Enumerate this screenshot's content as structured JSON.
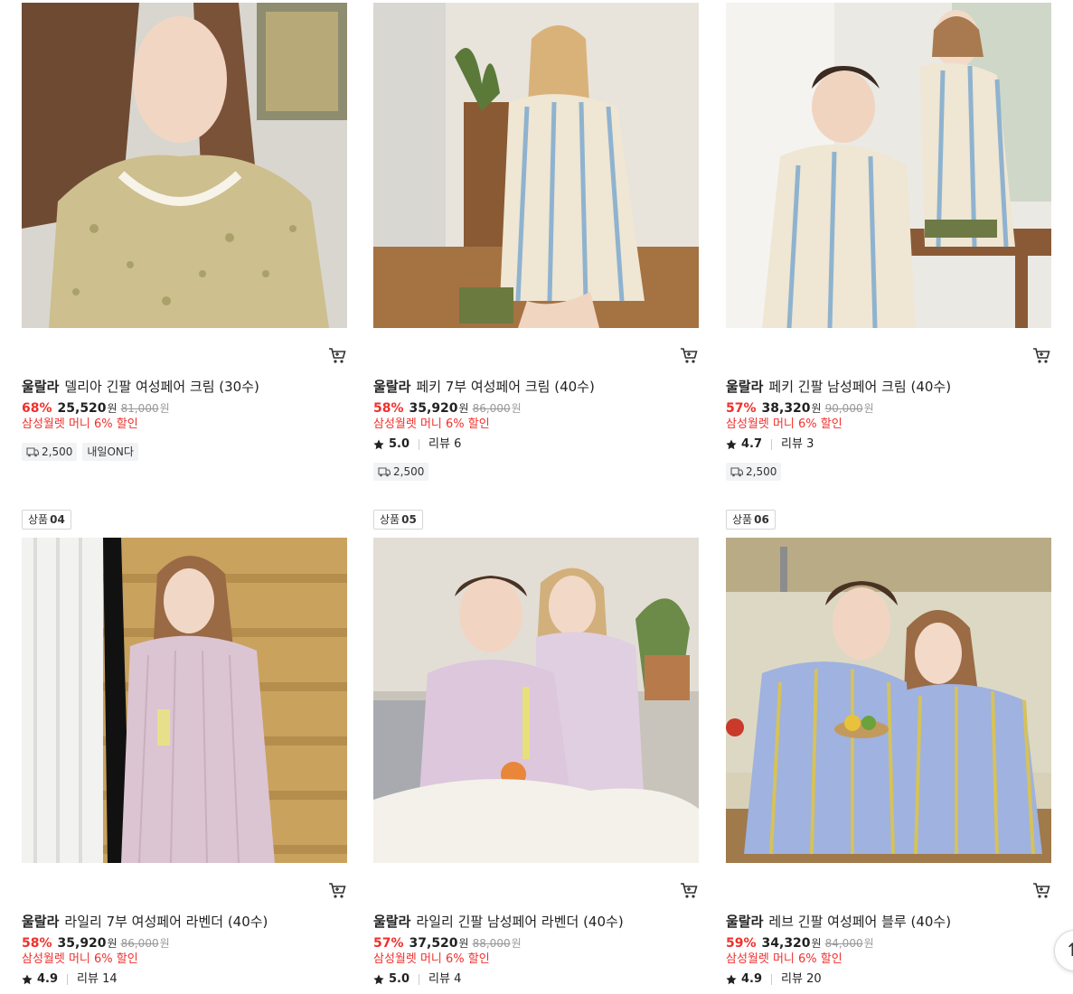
{
  "products": [
    {
      "brand": "울랄라",
      "name": "델리아 긴팔 여성페어 크림 (30수)",
      "discount": "68%",
      "price": "25,520",
      "unit": "원",
      "original": "81,000",
      "promo": "삼성월렛 머니 6% 할인",
      "shipping": "2,500",
      "delivery": "내일ON다"
    },
    {
      "brand": "울랄라",
      "name": "페키 7부 여성페어 크림 (40수)",
      "discount": "58%",
      "price": "35,920",
      "unit": "원",
      "original": "86,000",
      "promo": "삼성월렛 머니 6% 할인",
      "rating": "5.0",
      "reviews": "리뷰 6",
      "shipping": "2,500"
    },
    {
      "brand": "울랄라",
      "name": "페키 긴팔 남성페어 크림 (40수)",
      "discount": "57%",
      "price": "38,320",
      "unit": "원",
      "original": "90,000",
      "promo": "삼성월렛 머니 6% 할인",
      "rating": "4.7",
      "reviews": "리뷰 3",
      "shipping": "2,500"
    },
    {
      "rank_label": "상품",
      "rank": "04",
      "brand": "울랄라",
      "name": "라일리 7부 여성페어 라벤더 (40수)",
      "discount": "58%",
      "price": "35,920",
      "unit": "원",
      "original": "86,000",
      "promo": "삼성월렛 머니 6% 할인",
      "rating": "4.9",
      "reviews": "리뷰 14"
    },
    {
      "rank_label": "상품",
      "rank": "05",
      "brand": "울랄라",
      "name": "라일리 긴팔 남성페어 라벤더 (40수)",
      "discount": "57%",
      "price": "37,520",
      "unit": "원",
      "original": "88,000",
      "promo": "삼성월렛 머니 6% 할인",
      "rating": "5.0",
      "reviews": "리뷰 4"
    },
    {
      "rank_label": "상품",
      "rank": "06",
      "brand": "울랄라",
      "name": "레브 긴팔 여성페어 블루 (40수)",
      "discount": "59%",
      "price": "34,320",
      "unit": "원",
      "original": "84,000",
      "promo": "삼성월렛 머니 6% 할인",
      "rating": "4.9",
      "reviews": "리뷰 20"
    }
  ],
  "colors": {
    "discount": "#f0302c",
    "promo": "#f0302c",
    "tag_bg": "#f2f3f5"
  },
  "icons": {
    "cart": "cart-icon",
    "star": "star-icon",
    "truck": "truck-icon",
    "scroll_top": "arrow-up-icon"
  }
}
